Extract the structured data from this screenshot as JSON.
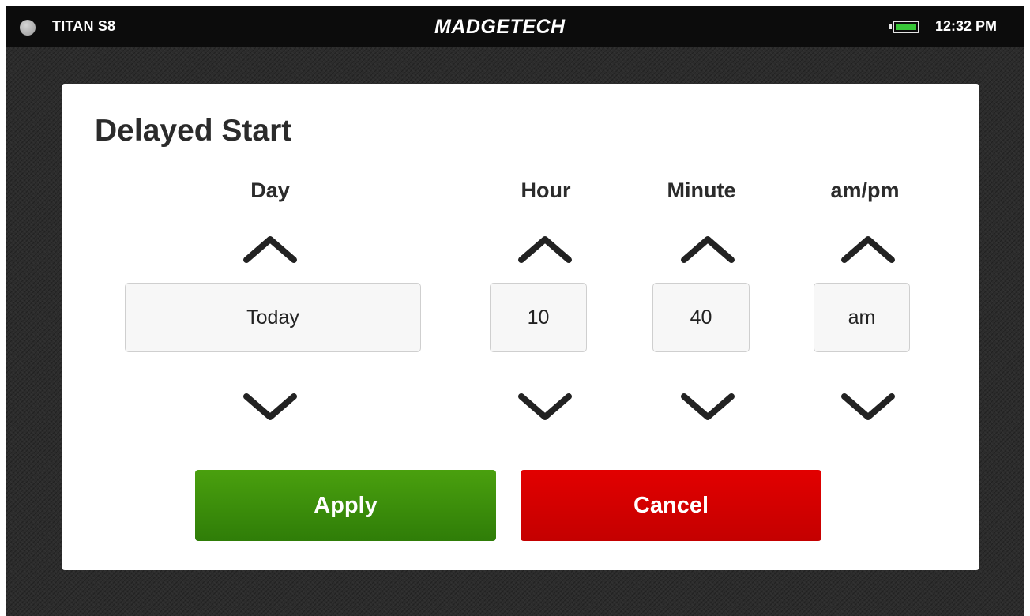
{
  "statusbar": {
    "device_name": "TITAN S8",
    "brand": "MADGETECH",
    "battery_level": 1.0,
    "time": "12:32 PM"
  },
  "dialog": {
    "title": "Delayed Start",
    "columns": [
      {
        "label": "Day",
        "value": "Today"
      },
      {
        "label": "Hour",
        "value": "10"
      },
      {
        "label": "Minute",
        "value": "40"
      },
      {
        "label": "am/pm",
        "value": "am"
      }
    ],
    "apply_label": "Apply",
    "cancel_label": "Cancel"
  },
  "colors": {
    "status_dot": "#b8b8b8",
    "battery_fill": "#38c838",
    "apply": "#3a8c0b",
    "cancel": "#d40000",
    "background": "#2c2c2c"
  },
  "icons": {
    "up_arrow": "chevron-up-icon",
    "down_arrow": "chevron-down-icon"
  }
}
